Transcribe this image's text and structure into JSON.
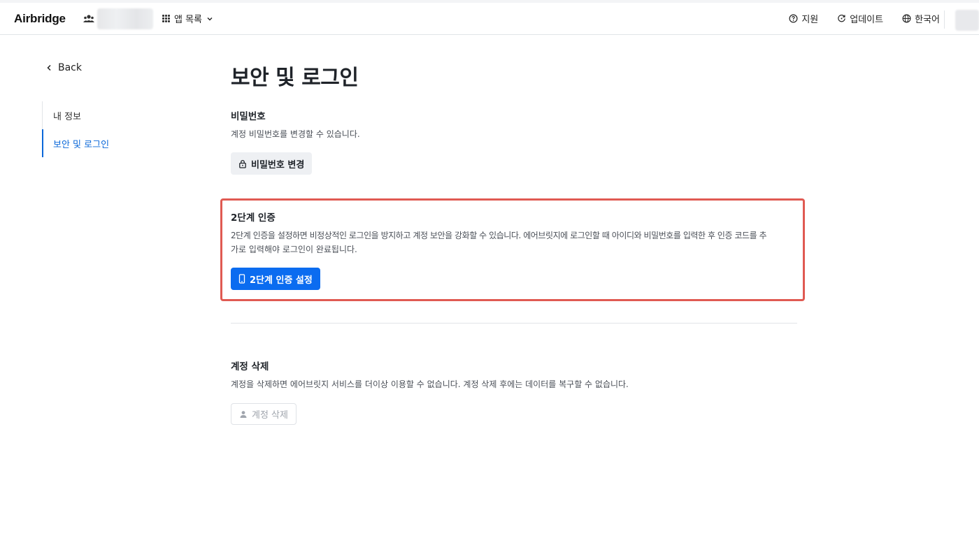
{
  "header": {
    "logo": "Airbridge",
    "apps_label": "앱 목록",
    "support_label": "지원",
    "updates_label": "업데이트",
    "language_label": "한국어"
  },
  "sidebar": {
    "back_label": "Back",
    "items": [
      {
        "label": "내 정보",
        "active": false
      },
      {
        "label": "보안 및 로그인",
        "active": true
      }
    ]
  },
  "main": {
    "title": "보안 및 로그인",
    "password": {
      "title": "비밀번호",
      "description": "계정 비밀번호를 변경할 수 있습니다.",
      "button_label": "비밀번호 변경"
    },
    "two_factor": {
      "title": "2단계 인증",
      "description_line1": "2단계 인증을 설정하면 비정상적인 로그인을 방지하고 계정 보안을 강화할 수 있습니다. 에어브릿지에 로그인할 때 아이디와 비밀번호를 입력한 후 인증 코드를 추",
      "description_line2": "가로 입력해야 로그인이 완료됩니다.",
      "button_label": "2단계 인증 설정"
    },
    "delete_account": {
      "title": "계정 삭제",
      "description": "계정을 삭제하면 에어브릿지 서비스를 더이상 이용할 수 없습니다. 계정 삭제 후에는 데이터를 복구할 수 없습니다.",
      "button_label": "계정 삭제"
    }
  },
  "colors": {
    "accent": "#0b6cf0",
    "active_nav": "#0b68d9",
    "highlight_border": "#e05a52"
  }
}
